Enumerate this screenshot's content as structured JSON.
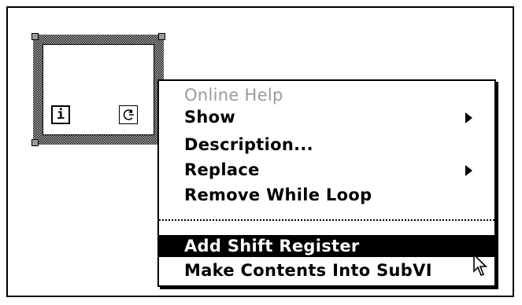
{
  "loop": {
    "iteration_terminal": "i"
  },
  "menu": {
    "items": [
      {
        "label": "Online Help",
        "disabled": true,
        "submenu": false
      },
      {
        "label": "Show",
        "disabled": false,
        "submenu": true
      },
      {
        "label": "Description...",
        "disabled": false,
        "submenu": false
      },
      {
        "label": "Replace",
        "disabled": false,
        "submenu": true
      },
      {
        "label": "Remove While Loop",
        "disabled": false,
        "submenu": false
      },
      {
        "label": "Add Shift Register",
        "disabled": false,
        "submenu": false,
        "selected": true
      },
      {
        "label": "Make Contents Into SubVI",
        "disabled": false,
        "submenu": false
      }
    ]
  },
  "colors": {
    "selection_bg": "#000000",
    "disabled_text": "#9a9a9a"
  }
}
